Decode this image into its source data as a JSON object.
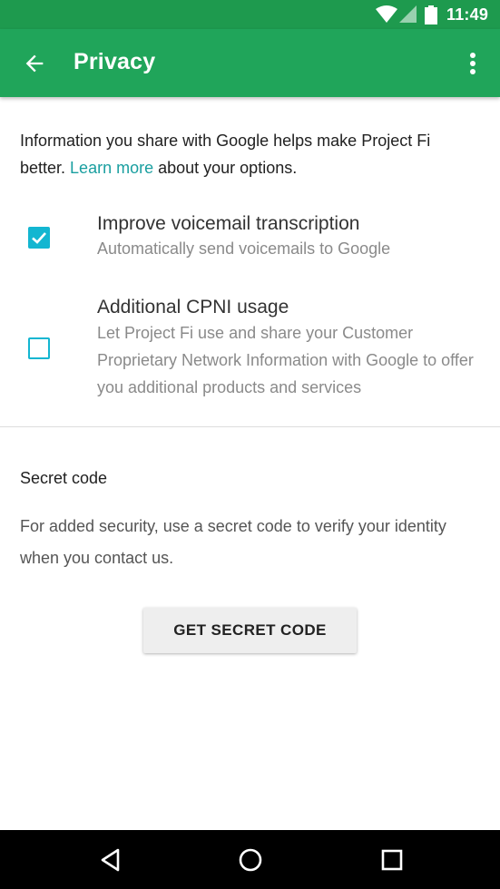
{
  "status_bar": {
    "time": "11:49",
    "icons": [
      "wifi-icon",
      "cell-signal-icon",
      "battery-icon"
    ]
  },
  "app_bar": {
    "title": "Privacy",
    "back_icon": "arrow-back-icon",
    "menu_icon": "more-vert-icon",
    "color": "#20a55a"
  },
  "intro": {
    "text_before": "Information you share with Google helps make Project Fi better. ",
    "link": "Learn more",
    "text_after": " about your options."
  },
  "settings": [
    {
      "title": "Improve voicemail transcription",
      "subtitle": "Automatically send voicemails to Google",
      "checked": true
    },
    {
      "title": "Additional CPNI usage",
      "subtitle": "Let Project Fi use and share your Customer Proprietary Network Information with Google to offer you additional products and services",
      "checked": false
    }
  ],
  "secret_code": {
    "title": "Secret code",
    "description": "For added security, use a secret code to verify your identity when you contact us.",
    "button_label": "GET SECRET CODE"
  },
  "nav_bar": {
    "icons": [
      "back-triangle-icon",
      "home-circle-icon",
      "recents-square-icon"
    ]
  },
  "colors": {
    "status_bar": "#1e9a4e",
    "accent": "#13b6d1",
    "link": "#1a9fa0"
  }
}
